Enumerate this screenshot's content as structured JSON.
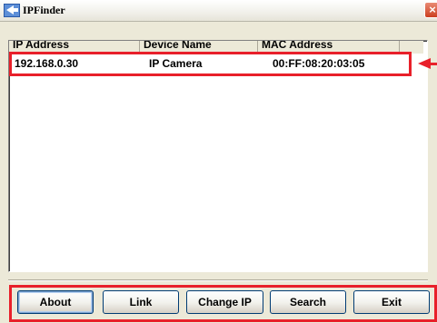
{
  "window": {
    "title": "IPFinder",
    "close_symbol": "×"
  },
  "table": {
    "headers": [
      "IP Address",
      "Device Name",
      "MAC Address"
    ],
    "rows": [
      [
        "192.168.0.30",
        "IP Camera",
        "00:FF:08:20:03:05"
      ]
    ]
  },
  "buttons": {
    "about": "About",
    "link": "Link",
    "change_ip": "Change IP",
    "search": "Search",
    "exit": "Exit"
  },
  "icons": {
    "app": "ipfinder-app-icon",
    "close": "close-icon",
    "pointer": "arrow-left-icon"
  },
  "colors": {
    "highlight": "#e8202a",
    "close_button": "#cc3f20"
  }
}
